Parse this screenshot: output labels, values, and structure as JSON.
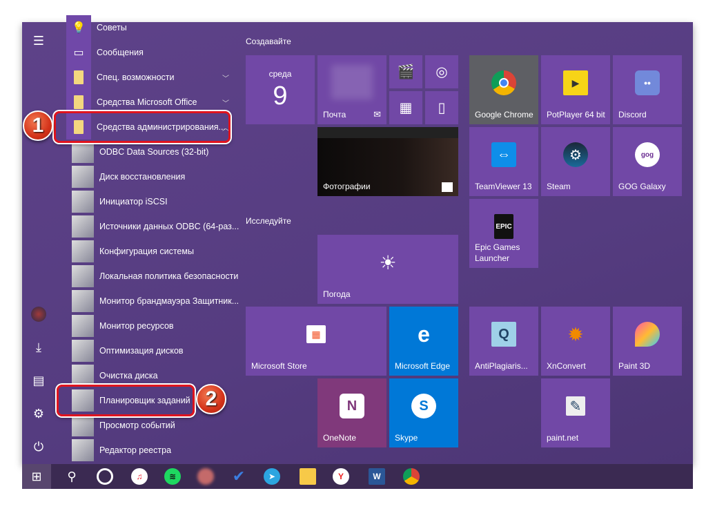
{
  "apps_list": [
    {
      "label": "Советы",
      "icon": "lightbulb-icon"
    },
    {
      "label": "Сообщения",
      "icon": "message-icon"
    },
    {
      "label": "Спец. возможности",
      "icon": "folder-icon",
      "expandable": true
    },
    {
      "label": "Средства Microsoft Office",
      "icon": "folder-icon",
      "expandable": true
    },
    {
      "label": "Средства администрирования...",
      "icon": "folder-icon",
      "expanded": true
    }
  ],
  "admin_tools": [
    "ODBC Data Sources (32-bit)",
    "Диск восстановления",
    "Инициатор iSCSI",
    "Источники данных ODBC (64-раз...",
    "Конфигурация системы",
    "Локальная политика безопасности",
    "Монитор брандмауэра Защитник...",
    "Монитор ресурсов",
    "Оптимизация дисков",
    "Очистка диска",
    "Планировщик заданий",
    "Просмотр событий",
    "Редактор реестра"
  ],
  "sections": {
    "create": "Создавайте",
    "explore": "Исследуйте"
  },
  "calendar": {
    "day": "среда",
    "date": "9"
  },
  "tiles": {
    "mail": "Почта",
    "photos": "Фотографии",
    "weather": "Погода",
    "store": "Microsoft Store",
    "edge": "Microsoft Edge",
    "onenote": "OneNote",
    "skype": "Skype",
    "chrome": "Google Chrome",
    "potplayer": "PotPlayer 64 bit",
    "discord": "Discord",
    "teamviewer": "TeamViewer 13",
    "steam": "Steam",
    "gog": "GOG Galaxy",
    "epic": "Epic Games Launcher",
    "antiplag": "AntiPlagiaris...",
    "xnconvert": "XnConvert",
    "paint3d": "Paint 3D",
    "paintnet": "paint.net"
  },
  "callouts": [
    "1",
    "2"
  ],
  "colors": {
    "tile": "#7148a6",
    "background": "#553c80",
    "taskbar": "#3b2a52",
    "highlight": "#e0141e"
  }
}
